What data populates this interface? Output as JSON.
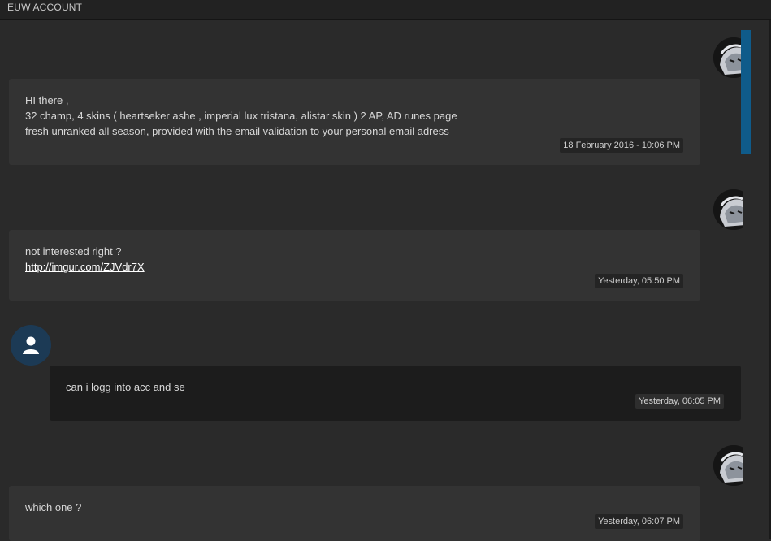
{
  "header": {
    "title": "EUW ACCOUNT"
  },
  "messages": [
    {
      "sender": "other",
      "lines": [
        "HI there ,",
        "32 champ, 4 skins ( heartseker ashe , imperial lux tristana, alistar skin ) 2 AP, AD runes page",
        "fresh unranked all season, provided with the email validation to your personal email adress"
      ],
      "timestamp": "18 February 2016 - 10:06 PM"
    },
    {
      "sender": "other",
      "lines": [
        "not interested right ?"
      ],
      "link": "http://imgur.com/ZJVdr7X",
      "timestamp": "Yesterday, 05:50 PM"
    },
    {
      "sender": "me",
      "lines": [
        "can i logg into acc and se"
      ],
      "timestamp": "Yesterday, 06:05 PM"
    },
    {
      "sender": "other",
      "lines": [
        "which one ?"
      ],
      "timestamp": "Yesterday, 06:07 PM"
    }
  ],
  "icons": {
    "other_avatar": "anime-avatar-icon",
    "me_avatar": "user-icon"
  },
  "colors": {
    "scrollbar": "#0f5b8a",
    "avatar_generic_bg": "#1c3a55",
    "bubble_other": "#333333",
    "bubble_me": "#1c1c1c"
  }
}
